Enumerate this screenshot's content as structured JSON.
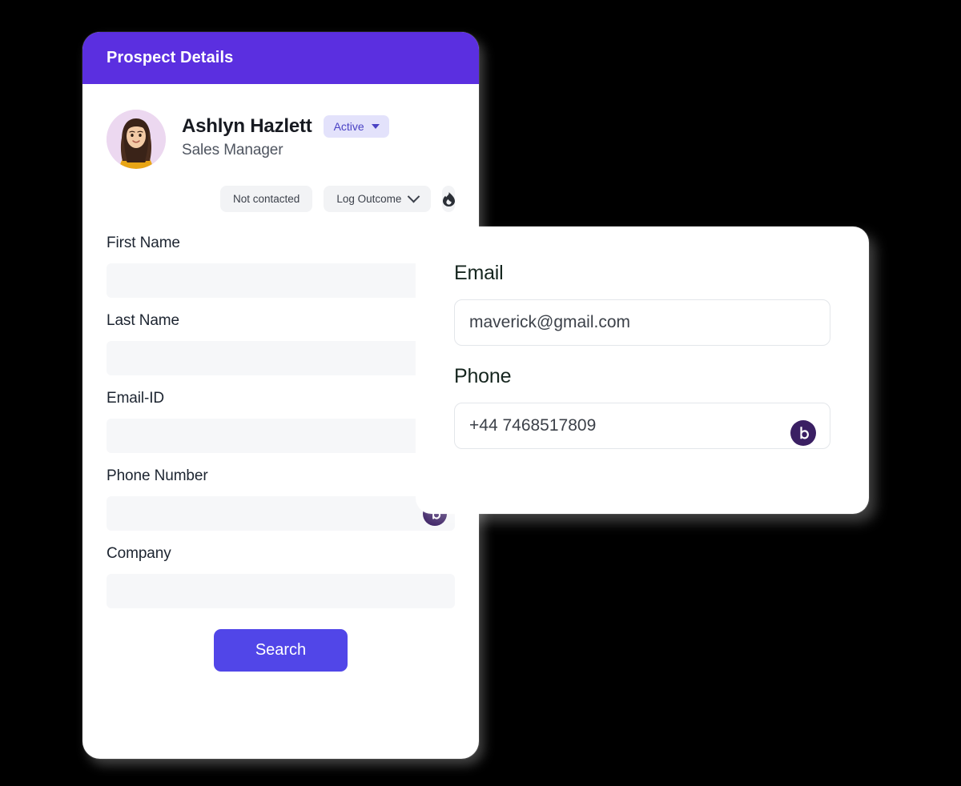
{
  "prospect_card": {
    "header": {
      "title": "Prospect Details"
    },
    "profile": {
      "avatar_icon": "user-avatar-photo",
      "name": "Ashlyn Hazlett",
      "role": "Sales Manager",
      "status_badge": {
        "label": "Active",
        "caret_icon": "caret-down-icon"
      }
    },
    "actions": {
      "not_contacted_label": "Not contacted",
      "log_outcome_label": "Log Outcome",
      "log_outcome_icon": "chevron-down-icon",
      "flame_icon": "flame-icon"
    },
    "fields": [
      {
        "label": "First Name",
        "value": "",
        "placeholder": "",
        "has_badge": false
      },
      {
        "label": "Last Name",
        "value": "",
        "placeholder": "",
        "has_badge": false
      },
      {
        "label": "Email-ID",
        "value": "",
        "placeholder": "",
        "has_badge": false
      },
      {
        "label": "Phone Number",
        "value": "",
        "placeholder": "",
        "has_badge": true,
        "badge_icon": "b-logo-icon"
      },
      {
        "label": "Company",
        "value": "",
        "placeholder": "",
        "has_badge": false
      }
    ],
    "search_button": {
      "label": "Search"
    }
  },
  "contact_card": {
    "email": {
      "label": "Email",
      "value": "maverick@gmail.com",
      "placeholder": "Email"
    },
    "phone": {
      "label": "Phone",
      "value": "+44 7468517809",
      "placeholder": "Phone",
      "badge_icon": "b-logo-icon"
    }
  },
  "colors": {
    "header_purple": "#5b2fe0",
    "search_button": "#5146e8",
    "badge_bg": "#e3e2fb",
    "badge_text": "#4a42c4",
    "b_logo_purple": "#3a1f63",
    "field_bg": "#f6f7f9",
    "pill_bg": "#f2f3f5",
    "page_background": "#000000"
  }
}
